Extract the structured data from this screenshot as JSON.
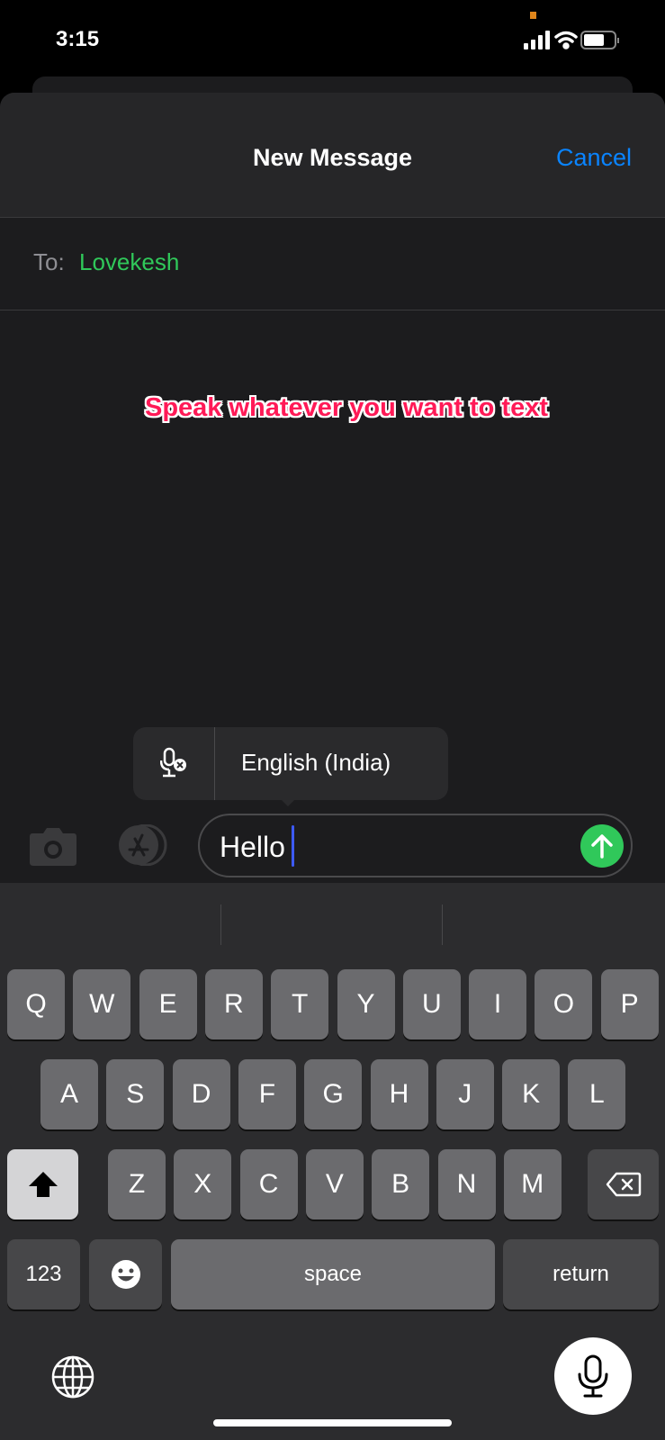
{
  "status_bar": {
    "time": "3:15",
    "signal_icon": "cellular-signal-icon",
    "wifi_icon": "wifi-icon",
    "battery_icon": "battery-icon"
  },
  "header": {
    "title": "New Message",
    "cancel_label": "Cancel"
  },
  "recipient": {
    "label": "To:",
    "name": "Lovekesh"
  },
  "annotation": "Speak whatever you want to text",
  "dictation_popup": {
    "icon": "microphone-off-icon",
    "language": "English (India)"
  },
  "compose": {
    "camera_icon": "camera-icon",
    "apps_icon": "app-store-icon",
    "text": "Hello",
    "send_icon": "arrow-up-icon"
  },
  "keyboard": {
    "row1": [
      "Q",
      "W",
      "E",
      "R",
      "T",
      "Y",
      "U",
      "I",
      "O",
      "P"
    ],
    "row2": [
      "A",
      "S",
      "D",
      "F",
      "G",
      "H",
      "J",
      "K",
      "L"
    ],
    "row3": [
      "Z",
      "X",
      "C",
      "V",
      "B",
      "N",
      "M"
    ],
    "numbers_label": "123",
    "space_label": "space",
    "return_label": "return",
    "shift_icon": "shift-icon",
    "delete_icon": "delete-icon",
    "emoji_icon": "emoji-icon",
    "globe_icon": "globe-icon",
    "mic_icon": "microphone-icon"
  },
  "colors": {
    "accent_blue": "#0a84ff",
    "recipient_green": "#30c85a",
    "send_green": "#30c85a",
    "annotation_pink": "#ff1a57"
  }
}
